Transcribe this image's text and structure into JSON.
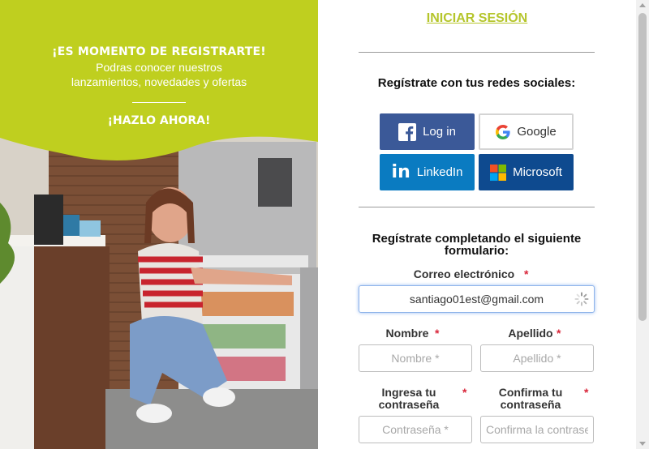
{
  "promo": {
    "headline": "¡ES MOMENTO DE REGISTRARTE!",
    "subtitle_line1": "Podras conocer nuestros",
    "subtitle_line2": "lanzamientos, novedades y ofertas",
    "cta": "¡HAZLO AHORA!",
    "accent_color": "#bfcf1f"
  },
  "form": {
    "login_link": "INICIAR SESIÓN",
    "social_title": "Regístrate con tus redes sociales:",
    "social_buttons": {
      "facebook": "Log in",
      "google": "Google",
      "linkedin": "LinkedIn",
      "microsoft": "Microsoft"
    },
    "form_title_line1": "Regístrate completando el siguiente",
    "form_title_line2": "formulario:",
    "email": {
      "label": "Correo electrónico",
      "required": "*",
      "value": "santiago01est@gmail.com"
    },
    "first_name": {
      "label": "Nombre",
      "required": "*",
      "placeholder": "Nombre *"
    },
    "last_name": {
      "label": "Apellido",
      "required": "*",
      "placeholder": "Apellido *"
    },
    "password": {
      "label_line1": "Ingresa tu",
      "label_line2": "contraseña",
      "required": "*",
      "placeholder": "Contraseña *"
    },
    "password_confirm": {
      "label_line1": "Confirma tu",
      "label_line2": "contraseña",
      "required": "*",
      "placeholder": "Confirma la contraseña *"
    }
  },
  "colors": {
    "login_link": "#b5c52b",
    "facebook": "#3b5998",
    "linkedin": "#0a7bc1",
    "microsoft": "#0e4a8f",
    "required": "#d9263a"
  }
}
